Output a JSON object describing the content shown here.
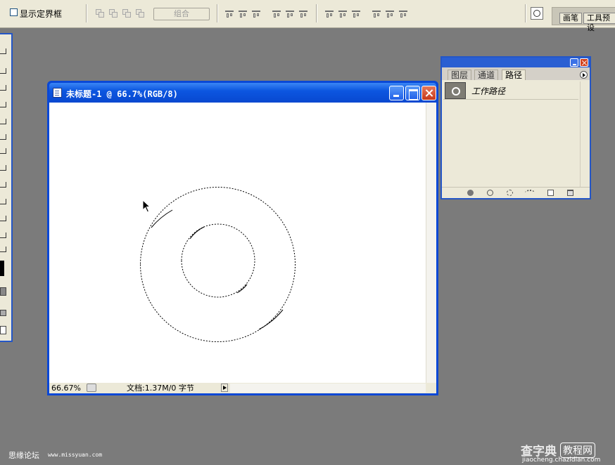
{
  "options_bar": {
    "show_bounding_box_label": "显示定界框",
    "show_bounding_box_checked": false,
    "combine_button_label": "组合",
    "well_tabs": [
      "画笔",
      "工具预设"
    ]
  },
  "document": {
    "title": "未标题-1 @ 66.7%(RGB/8)",
    "zoom_level": "66.67%",
    "doc_size": "文档:1.37M/0 字节"
  },
  "paths_palette": {
    "tabs": [
      "图层",
      "通道",
      "路径"
    ],
    "active_tab": "路径",
    "paths": [
      {
        "name": "工作路径"
      }
    ]
  },
  "watermarks": {
    "left_text": "思缘论坛",
    "left_url": "www.missyuan.com",
    "right_text": "查字典",
    "right_box": "教程网",
    "right_url": "jiaocheng.chazidian.com"
  },
  "colors": {
    "workspace": "#7b7b7b",
    "titlebar_blue": "#0c56e0",
    "panel_bg": "#ece9d8"
  }
}
